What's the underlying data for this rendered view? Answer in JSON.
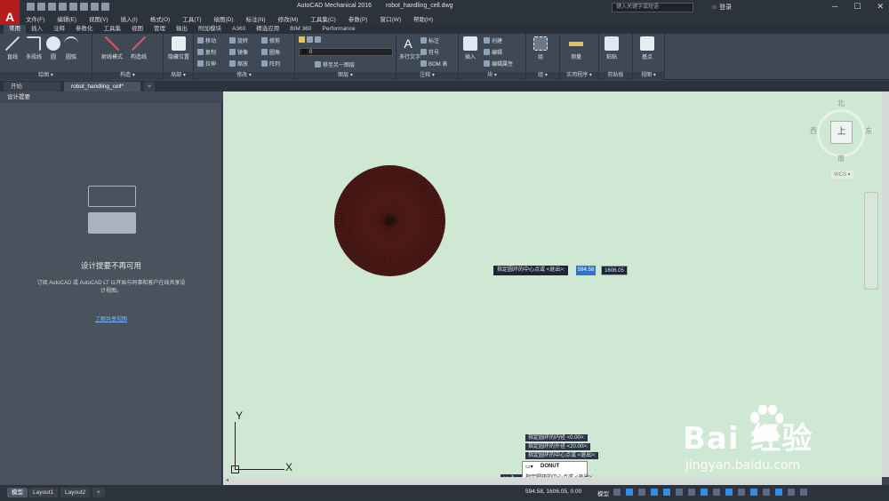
{
  "titlebar": {
    "app_title": "AutoCAD Mechanical 2016",
    "doc_title": "robot_handling_cell.dwg",
    "search_placeholder": "键入关键字或短语",
    "login": "登录",
    "app_logo": "A",
    "minimize": "─",
    "maximize": "☐",
    "close": "✕"
  },
  "menubar": [
    "文件(F)",
    "编辑(E)",
    "视图(V)",
    "插入(I)",
    "格式(O)",
    "工具(T)",
    "绘图(D)",
    "标注(N)",
    "修改(M)",
    "工具集(C)",
    "参数(P)",
    "窗口(W)",
    "帮助(H)"
  ],
  "ribbon_tabs": [
    "常用",
    "插入",
    "注释",
    "参数化",
    "工具集",
    "视图",
    "管理",
    "输出",
    "附加模块",
    "A360",
    "精选应用",
    "BIM 360",
    "Performance"
  ],
  "ribbon": {
    "draw": {
      "title": "绘图 ▾",
      "tools": [
        "直线",
        "多段线",
        "圆",
        "圆弧"
      ]
    },
    "construct": {
      "title": "构造 ▾",
      "tools": [
        "射线模式",
        "构造线"
      ]
    },
    "layout": {
      "title": "局部 ▾",
      "tools": [
        "隐藏位置"
      ]
    },
    "modify": {
      "title": "修改 ▾",
      "rows": [
        "移动",
        "旋转",
        "修剪",
        "复制",
        "镜像",
        "圆角",
        "拉伸",
        "缩放",
        "阵列"
      ]
    },
    "layers": {
      "title": "图层 ▾",
      "combo": "0",
      "row": "移至另一图层"
    },
    "annotation": {
      "title": "注释 ▾",
      "tools": [
        "多行文字"
      ],
      "rows": [
        "标注",
        "符号",
        "BOM 表"
      ]
    },
    "block": {
      "title": "块 ▾",
      "tools": [
        "插入"
      ],
      "rows": [
        "创建",
        "编辑",
        "编辑属性"
      ]
    },
    "groups": {
      "title": "组 ▾",
      "tools": [
        "组"
      ]
    },
    "utilities": {
      "title": "实用程序 ▾",
      "tools": [
        "测量"
      ]
    },
    "clipboard": {
      "title": "剪贴板",
      "tools": [
        "粘贴"
      ]
    },
    "view": {
      "title": "视图 ▾",
      "tools": [
        "基点"
      ]
    }
  },
  "file_tabs": {
    "start": "开始",
    "doc": "robot_handling_cell*",
    "plus": "+"
  },
  "palette": {
    "title": "设计提要",
    "heading": "设计提要不再可用",
    "body": "订阅 AutoCAD 或 AutoCAD LT 以开始与同事和客户在线共享设计视图。",
    "link": "了解共享视图"
  },
  "canvas": {
    "dynamic_prompt": "指定圆环的中心点或 <退出>:",
    "dynamic_x": "594.58",
    "dynamic_y": "1606.05",
    "ucs_x": "X",
    "ucs_y": "Y"
  },
  "viewcube": {
    "north": "北",
    "south": "南",
    "east": "东",
    "west": "西",
    "face": "上",
    "wcs": "WCS ▾"
  },
  "command": {
    "history": [
      "指定圆环的内径 <0.00>:",
      "指定圆环的外径 <20.00>:",
      "指定圆环的中心点或 <退出>:"
    ],
    "current_name": "DONUT",
    "current_prompt": "指定圆环的中心点或 <退出>:"
  },
  "watermark": {
    "brand": "Bai  经验",
    "url": "jingyan.baidu.com"
  },
  "status": {
    "layout_tabs": [
      "模型",
      "Layout1",
      "Layout2",
      "+"
    ],
    "coords": "594.58, 1606.05, 0.00",
    "mode": "模型"
  },
  "colors": {
    "canvas_bg": "#cfe8d4",
    "donut_fill": "#4a1713",
    "accent": "#2c74d4"
  }
}
